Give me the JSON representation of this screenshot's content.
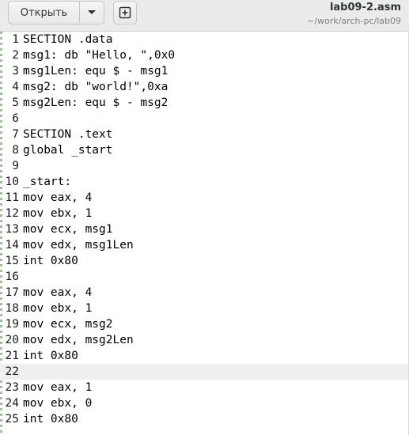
{
  "toolbar": {
    "open_label": "Открыть",
    "open_menu_icon": "chevron-down-icon",
    "new_tab_icon": "new-tab-icon"
  },
  "document": {
    "title": "lab09-2.asm",
    "path": "~/work/arch-pc/lab09"
  },
  "editor": {
    "current_line": 22,
    "lines": [
      {
        "number": "1",
        "text": "SECTION .data"
      },
      {
        "number": "2",
        "text": "msg1: db \"Hello, \",0x0"
      },
      {
        "number": "3",
        "text": "msg1Len: equ $ - msg1"
      },
      {
        "number": "4",
        "text": "msg2: db \"world!\",0xa"
      },
      {
        "number": "5",
        "text": "msg2Len: equ $ - msg2"
      },
      {
        "number": "6",
        "text": ""
      },
      {
        "number": "7",
        "text": "SECTION .text"
      },
      {
        "number": "8",
        "text": "global _start"
      },
      {
        "number": "9",
        "text": ""
      },
      {
        "number": "10",
        "text": "_start:"
      },
      {
        "number": "11",
        "text": "mov eax, 4"
      },
      {
        "number": "12",
        "text": "mov ebx, 1"
      },
      {
        "number": "13",
        "text": "mov ecx, msg1"
      },
      {
        "number": "14",
        "text": "mov edx, msg1Len"
      },
      {
        "number": "15",
        "text": "int 0x80"
      },
      {
        "number": "16",
        "text": ""
      },
      {
        "number": "17",
        "text": "mov eax, 4"
      },
      {
        "number": "18",
        "text": "mov ebx, 1"
      },
      {
        "number": "19",
        "text": "mov ecx, msg2"
      },
      {
        "number": "20",
        "text": "mov edx, msg2Len"
      },
      {
        "number": "21",
        "text": "int 0x80"
      },
      {
        "number": "22",
        "text": ""
      },
      {
        "number": "23",
        "text": "mov eax, 1"
      },
      {
        "number": "24",
        "text": "mov ebx, 0"
      },
      {
        "number": "25",
        "text": "int 0x80"
      }
    ]
  }
}
